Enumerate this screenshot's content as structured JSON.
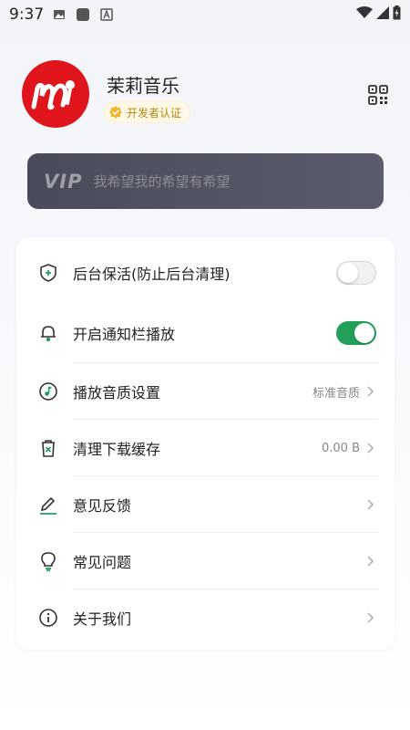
{
  "status_bar": {
    "time": "9:37"
  },
  "profile": {
    "name": "茉莉音乐",
    "badge": "开发者认证"
  },
  "vip": {
    "logo": "VIP",
    "text": "我希望我的希望有希望"
  },
  "settings": {
    "items": [
      {
        "label": "后台保活(防止后台清理)",
        "type": "toggle",
        "on": false,
        "icon": "shield-plus-icon"
      },
      {
        "label": "开启通知栏播放",
        "type": "toggle",
        "on": true,
        "icon": "bell-icon"
      },
      {
        "label": "播放音质设置",
        "value": "标准音质",
        "type": "nav",
        "icon": "music-note-icon"
      },
      {
        "label": "清理下载缓存",
        "value": "0.00 B",
        "type": "nav",
        "icon": "trash-icon"
      },
      {
        "label": "意见反馈",
        "type": "nav",
        "icon": "pencil-icon"
      },
      {
        "label": "常见问题",
        "type": "nav",
        "icon": "lightbulb-icon"
      },
      {
        "label": "关于我们",
        "type": "nav",
        "icon": "info-icon"
      }
    ]
  },
  "colors": {
    "accent_green": "#22a05a",
    "brand_red": "#e0141c",
    "vip_bg": "#4a4b5a"
  }
}
